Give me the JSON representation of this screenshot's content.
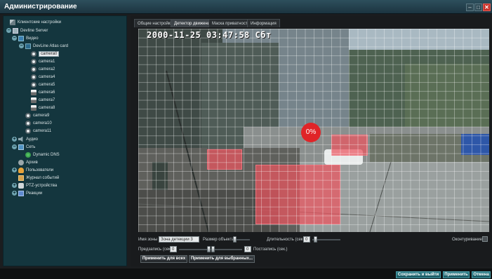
{
  "window": {
    "title": "Администрирование"
  },
  "tree": {
    "client_settings": "Клиентские настройки",
    "server": "Devline Server",
    "video": "Видео",
    "card": "DevLine Atlas card",
    "cameras_card": [
      "camera0",
      "camera1",
      "camera2",
      "camera4",
      "camera5",
      "camera6",
      "camera7",
      "camera8"
    ],
    "cameras_other": [
      "camera9",
      "camera10",
      "camera11"
    ],
    "audio": "Аудио",
    "network": "Сеть",
    "dynamic_dns": "Dynamic DNS",
    "archive": "Архив",
    "users": "Пользователи",
    "journal": "Журнал событий",
    "ptz": "PTZ-устройства",
    "reactions": "Реакции"
  },
  "tabs": [
    "Общие настройки",
    "Детектор движения",
    "Маска приватности",
    "Информация"
  ],
  "active_tab": "Детектор движения",
  "video": {
    "timestamp": "2000-11-25 03:47:58 Cбт",
    "motion_percent": "0%",
    "zone_color": "#eb555f"
  },
  "controls": {
    "zone_name_label": "Имя зоны",
    "zone_name_value": "Зона детекции 3",
    "object_size_label": "Размер объекта",
    "object_size_value": "",
    "duration_label": "Длительность (сек.)",
    "duration_value": "0",
    "outline_label": "Оконтуривание",
    "pre_label": "Предзапись (сек.)",
    "pre_value": "0",
    "post_value": "0",
    "post_label": "Постзапись (сек.)",
    "apply_all": "Применить для всех",
    "apply_selected": "Применить для выбранных..."
  },
  "footer": {
    "save_exit": "Сохранить и выйти",
    "apply": "Применить",
    "cancel": "Отмена"
  },
  "colors": {
    "accent": "#2f7f8a",
    "close": "#c8322a",
    "badge": "#e02428"
  }
}
